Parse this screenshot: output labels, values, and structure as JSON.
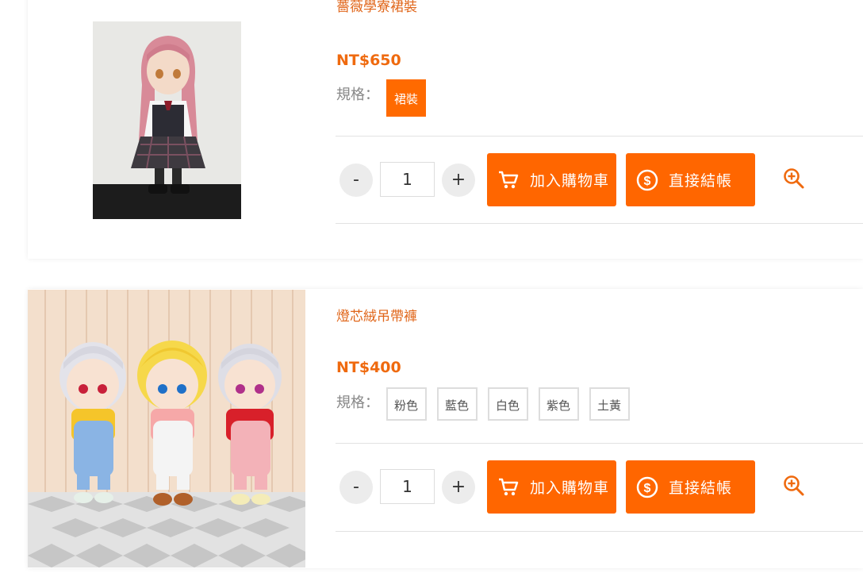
{
  "products": [
    {
      "title": "薔薇學寮裙裝",
      "price": "NT$650",
      "spec_label": "規格：",
      "options": [
        "裙裝"
      ],
      "selected_option": "裙裝",
      "quantity": "1",
      "minus": "-",
      "plus": "+",
      "add_to_cart": "加入購物車",
      "checkout": "直接結帳"
    },
    {
      "title": "燈芯絨吊帶褲",
      "price": "NT$400",
      "spec_label": "規格：",
      "options": [
        "粉色",
        "藍色",
        "白色",
        "紫色",
        "土黃"
      ],
      "quantity": "1",
      "minus": "-",
      "plus": "+",
      "add_to_cart": "加入購物車",
      "checkout": "直接結帳"
    }
  ],
  "colors": {
    "accent": "#ff6600",
    "price": "#ef6a0f",
    "title": "#e0661a"
  }
}
